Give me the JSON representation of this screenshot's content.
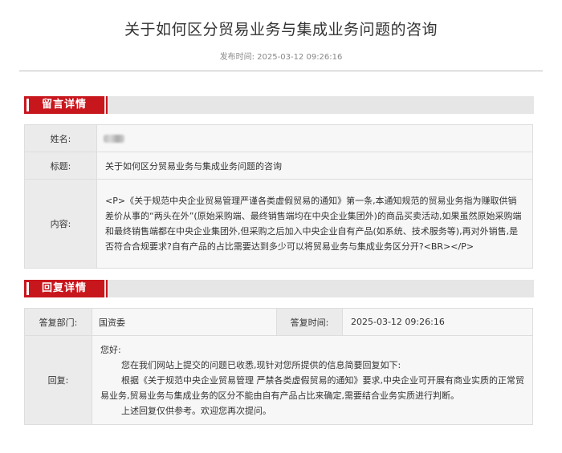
{
  "page": {
    "title": "关于如何区分贸易业务与集成业务问题的咨询",
    "publish_label": "发布时间:",
    "publish_time": "2025-03-12 09:26:16"
  },
  "message": {
    "section_title": "留言详情",
    "name_label": "姓名:",
    "subject_label": "标题:",
    "subject_value": "关于如何区分贸易业务与集成业务问题的咨询",
    "content_label": "内容:",
    "content_value": "<P>《关于规范中央企业贸易管理严谨各类虚假贸易的通知》第一条,本通知规范的贸易业务指为赚取供销差价从事的“两头在外”(原始采购端、最终销售端均在中央企业集团外)的商品买卖活动,如果虽然原始采购端和最终销售端都在中央企业集团外,但采购之后加入中央企业自有产品(如系统、技术服务等),再对外销售,是否符合合规要求?自有产品的占比需要达到多少可以将贸易业务与集成业务区分开?<BR></P>"
  },
  "reply": {
    "section_title": "回复详情",
    "dept_label": "答复部门:",
    "dept_value": "国资委",
    "time_label": "答复时间:",
    "time_value": "2025-03-12 09:26:16",
    "reply_label": "回复:",
    "greeting": "您好:",
    "para1": "您在我们网站上提交的问题已收悉,现针对您所提供的信息简要回复如下:",
    "para2": "根据《关于规范中央企业贸易管理 严禁各类虚假贸易的通知》要求,中央企业可开展有商业实质的正常贸易业务,贸易业务与集成业务的区分不能由自有产品占比来确定,需要结合业务实质进行判断。",
    "para3": "上述回复仅供参考。欢迎您再次提问。"
  }
}
